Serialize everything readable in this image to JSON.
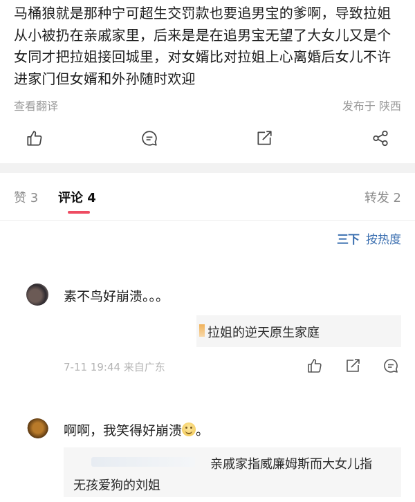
{
  "post": {
    "text": "马桶狼就是那种宁可超生交罚款也要追男宝的爹啊，导致拉姐从小被扔在亲戚家里，后来是是在追男宝无望了大女儿又是个女同才把拉姐接回城里，对女婿比对拉姐上心离婚后女儿不许进家门但女婿和外孙随时欢迎",
    "translate_label": "查看翻译",
    "location": "发布于 陕西"
  },
  "actions": {
    "like_icon": "thumb-up-icon",
    "comment_icon": "comment-icon",
    "share_icon": "external-share-icon",
    "more_icon": "share-nodes-icon"
  },
  "tabs": [
    {
      "label": "赞 3"
    },
    {
      "label": "评论 4"
    },
    {
      "label": "转发 2"
    }
  ],
  "sort": {
    "icon": "三下",
    "label": "按热度"
  },
  "comments": [
    {
      "text": "素不鸟好崩溃。。。",
      "quote": "拉姐的逆天原生家庭",
      "meta": "7-11 19:44  来自广东"
    },
    {
      "text": "啊啊，我笑得好崩溃",
      "emoji": "😊",
      "text_end": "。",
      "reply_line1": "亲戚家指威廉姆斯而大女儿指",
      "reply_line2": "无孩爱狗的刘姐"
    }
  ],
  "colors": {
    "accent": "#ee4c62",
    "link": "#3b6fb0",
    "muted": "#9a9a9a"
  }
}
